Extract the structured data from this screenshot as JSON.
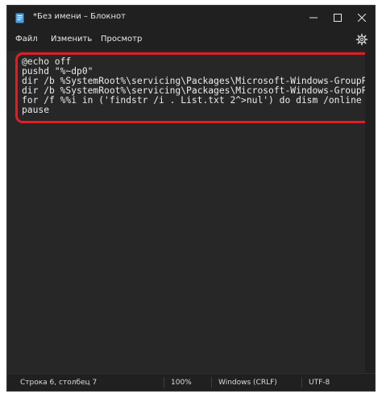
{
  "window": {
    "title": "*Без имени – Блокнот"
  },
  "menu": {
    "file": "Файл",
    "edit": "Изменить",
    "view": "Просмотр"
  },
  "editor": {
    "lines": [
      "@echo off",
      "pushd \"%~dp0\"",
      "dir /b %SystemRoot%\\servicing\\Packages\\Microsoft-Windows-GroupP",
      "dir /b %SystemRoot%\\servicing\\Packages\\Microsoft-Windows-GroupP",
      "for /f %%i in ('findstr /i . List.txt 2^>nul') do dism /online",
      "pause"
    ]
  },
  "status": {
    "position": "Строка 6, столбец 7",
    "zoom": "100%",
    "line_endings": "Windows (CRLF)",
    "encoding": "UTF-8"
  },
  "icons": {
    "app": "notepad-icon",
    "minimize": "minimize-icon",
    "maximize": "maximize-icon",
    "close": "close-icon",
    "settings": "gear-icon"
  },
  "colors": {
    "highlight": "#e11d24",
    "editor_bg": "#272727",
    "chrome_bg": "#202020",
    "app_icon": "#4f9fe0"
  }
}
